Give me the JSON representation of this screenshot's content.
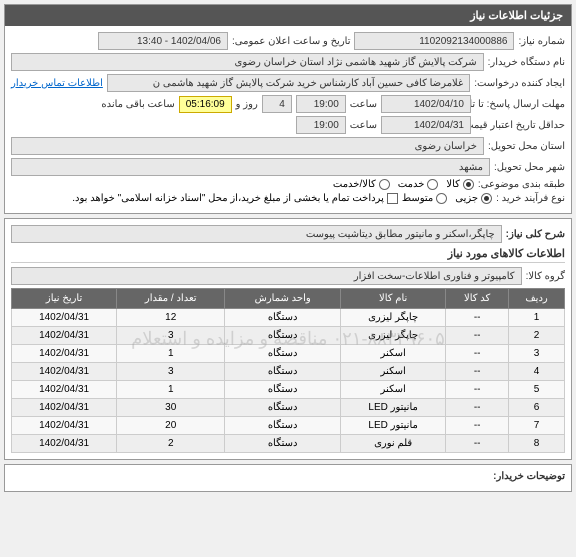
{
  "header": {
    "title": "جزئیات اطلاعات نیاز"
  },
  "info": {
    "need_no_label": "شماره نیاز:",
    "need_no": "1102092134000886",
    "announce_label": "تاریخ و ساعت اعلان عمومی:",
    "announce_value": "1402/04/06 - 13:40",
    "buyer_label": "نام دستگاه خریدار:",
    "buyer_value": "شرکت پالایش گاز شهید هاشمی نژاد   استان خراسان رضوی",
    "creator_label": "ایجاد کننده درخواست:",
    "creator_value": "غلامرضا کافی حسین آباد کارشناس خرید  شرکت پالایش گاز شهید هاشمی ن",
    "contact_link": "اطلاعات تماس خریدار",
    "deadline_label": "مهلت ارسال پاسخ: تا تاریخ:",
    "deadline_date": "1402/04/10",
    "time_label_1": "ساعت",
    "deadline_time": "19:00",
    "day_label": "روز و",
    "days_remain": "4",
    "remain_label": "ساعت باقی مانده",
    "remain_time": "05:16:09",
    "validity_label": "حداقل تاریخ اعتبار قیمت: تا تاریخ:",
    "validity_date": "1402/04/31",
    "time_label_2": "ساعت",
    "validity_time": "19:00",
    "province_label": "استان محل تحویل:",
    "province_value": "خراسان رضوی",
    "city_label": "شهر محل تحویل:",
    "city_value": "مشهد",
    "classify_label": "طبقه بندی موضوعی:",
    "goods_radio": "کالا",
    "service_radio": "خدمت",
    "both_radio": "کالا/خدمت",
    "buy_type_label": "نوع فرآیند خرید :",
    "partial_radio": "جزیی",
    "medium_radio": "متوسط",
    "payment_note": "پرداخت تمام یا بخشی از مبلغ خرید،از محل \"اسناد خزانه اسلامی\" خواهد بود."
  },
  "need": {
    "desc_label": "شرح کلی نیاز:",
    "desc_value": "چاپگر،اسکنر و مانیتور مطابق دیتاشیت پیوست",
    "goods_section": "اطلاعات کالاهای مورد نیاز",
    "group_label": "گروه کالا:",
    "group_value": "کامپیوتر و فناوری اطلاعات-سخت افزار"
  },
  "table": {
    "headers": {
      "row": "ردیف",
      "code": "کد کالا",
      "name": "نام کالا",
      "unit": "واحد شمارش",
      "qty": "تعداد / مقدار",
      "date": "تاریخ نیاز"
    },
    "rows": [
      {
        "idx": "1",
        "code": "--",
        "name": "چاپگر لیزری",
        "unit": "دستگاه",
        "qty": "12",
        "date": "1402/04/31"
      },
      {
        "idx": "2",
        "code": "--",
        "name": "چاپگر لیزری",
        "unit": "دستگاه",
        "qty": "3",
        "date": "1402/04/31"
      },
      {
        "idx": "3",
        "code": "--",
        "name": "اسکنر",
        "unit": "دستگاه",
        "qty": "1",
        "date": "1402/04/31"
      },
      {
        "idx": "4",
        "code": "--",
        "name": "اسکنر",
        "unit": "دستگاه",
        "qty": "3",
        "date": "1402/04/31"
      },
      {
        "idx": "5",
        "code": "--",
        "name": "اسکنر",
        "unit": "دستگاه",
        "qty": "1",
        "date": "1402/04/31"
      },
      {
        "idx": "6",
        "code": "--",
        "name": "مانیتور LED",
        "unit": "دستگاه",
        "qty": "30",
        "date": "1402/04/31"
      },
      {
        "idx": "7",
        "code": "--",
        "name": "مانیتور LED",
        "unit": "دستگاه",
        "qty": "20",
        "date": "1402/04/31"
      },
      {
        "idx": "8",
        "code": "--",
        "name": "قلم نوری",
        "unit": "دستگاه",
        "qty": "2",
        "date": "1402/04/31"
      }
    ]
  },
  "footer": {
    "buyer_notes_label": "توضیحات خریدار:"
  },
  "watermark": "۰۲۱-۸۸۳۴۹۶۰۵ مناقصه و مزایده و استعلام"
}
